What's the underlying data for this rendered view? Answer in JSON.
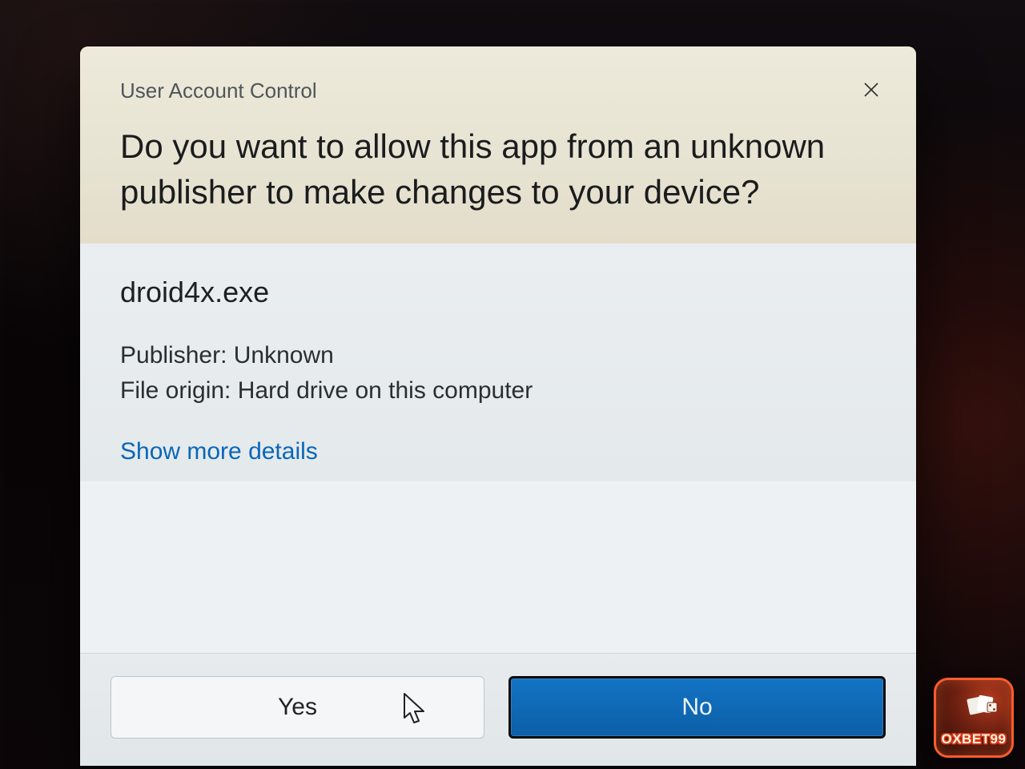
{
  "dialog": {
    "titlebar": "User Account Control",
    "heading": "Do you want to allow this app from an unknown publisher to make changes to your device?",
    "program_name": "droid4x.exe",
    "publisher_label": "Publisher:",
    "publisher_value": "Unknown",
    "origin_label": "File origin:",
    "origin_value": "Hard drive on this computer",
    "details_link": "Show more details",
    "buttons": {
      "yes": "Yes",
      "no": "No"
    }
  },
  "watermark": {
    "label": "OXBET99"
  }
}
